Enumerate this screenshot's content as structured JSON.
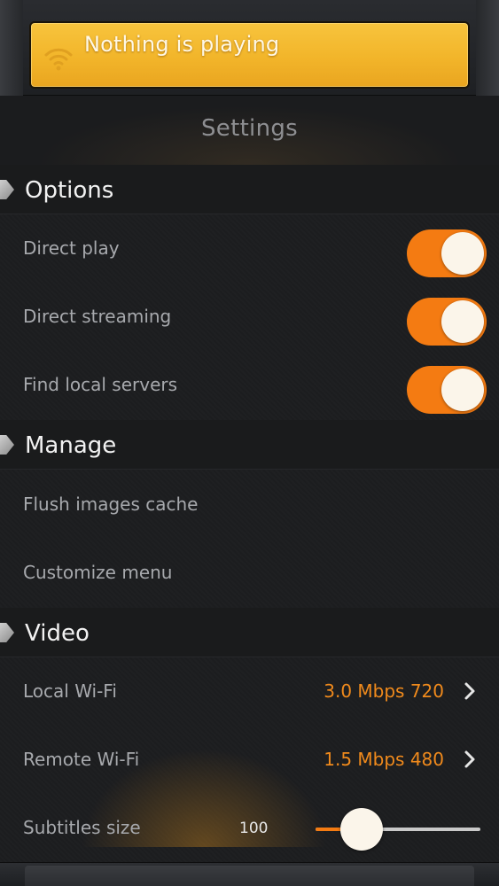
{
  "now_playing": {
    "text": "Nothing is playing",
    "icon": "wifi-icon"
  },
  "header": {
    "title": "Settings"
  },
  "sections": {
    "options": {
      "label": "Options",
      "items": [
        {
          "label": "Direct play",
          "enabled": true
        },
        {
          "label": "Direct streaming",
          "enabled": true
        },
        {
          "label": "Find local servers",
          "enabled": true
        }
      ]
    },
    "manage": {
      "label": "Manage",
      "items": [
        {
          "label": "Flush images cache"
        },
        {
          "label": "Customize menu"
        }
      ]
    },
    "video": {
      "label": "Video",
      "items": [
        {
          "label": "Local Wi-Fi",
          "value": "3.0 Mbps 720"
        },
        {
          "label": "Remote Wi-Fi",
          "value": "1.5 Mbps 480"
        }
      ],
      "subtitles": {
        "label": "Subtitles size",
        "value": "100"
      }
    }
  },
  "colors": {
    "accent": "#f47b12",
    "banner": "#f2b52a",
    "background": "#1c1d1f"
  }
}
